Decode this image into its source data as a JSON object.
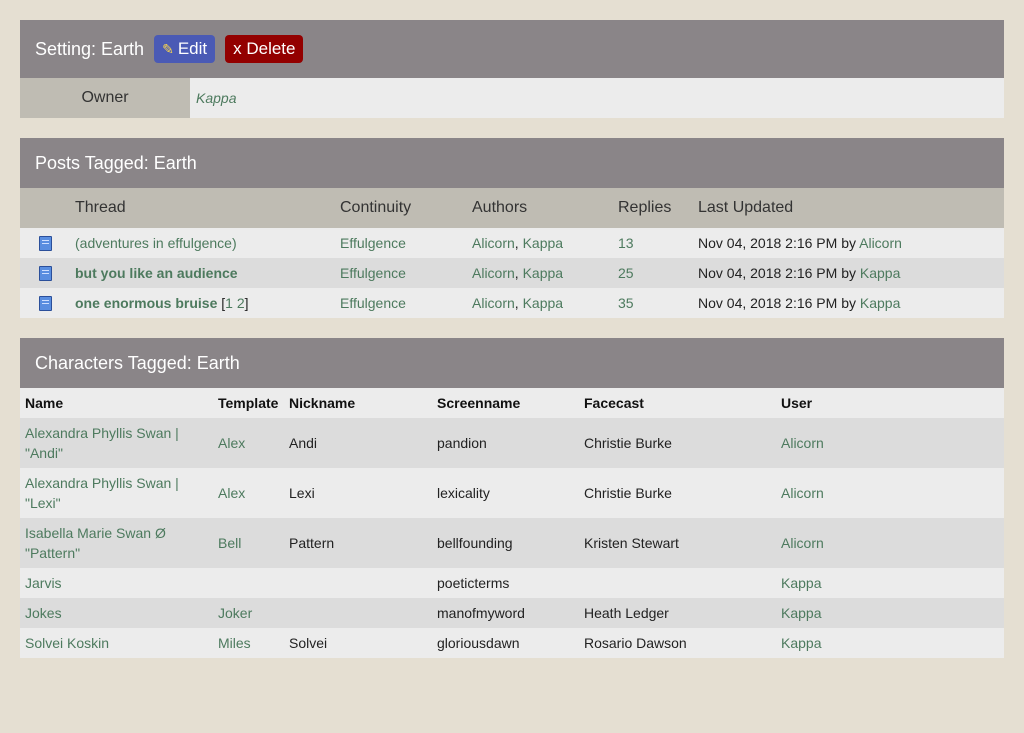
{
  "setting": {
    "title": "Setting: Earth",
    "edit_label": "Edit",
    "delete_label": "x Delete",
    "owner_label": "Owner",
    "owner_value": "Kappa"
  },
  "posts": {
    "title": "Posts Tagged: Earth",
    "columns": [
      "Thread",
      "Continuity",
      "Authors",
      "Replies",
      "Last Updated"
    ],
    "rows": [
      {
        "thread": "(adventures in effulgence)",
        "pages": [],
        "continuity": "Effulgence",
        "authors": [
          "Alicorn",
          "Kappa"
        ],
        "replies": "13",
        "updated": "Nov 04, 2018 2:16 PM",
        "by_word": "by",
        "updated_by": "Alicorn",
        "bold": false
      },
      {
        "thread": "but you like an audience",
        "pages": [],
        "continuity": "Effulgence",
        "authors": [
          "Alicorn",
          "Kappa"
        ],
        "replies": "25",
        "updated": "Nov 04, 2018 2:16 PM",
        "by_word": "by",
        "updated_by": "Kappa",
        "bold": true
      },
      {
        "thread": "one enormous bruise",
        "pages": [
          "1",
          "2"
        ],
        "continuity": "Effulgence",
        "authors": [
          "Alicorn",
          "Kappa"
        ],
        "replies": "35",
        "updated": "Nov 04, 2018 2:16 PM",
        "by_word": "by",
        "updated_by": "Kappa",
        "bold": true
      }
    ]
  },
  "characters": {
    "title": "Characters Tagged: Earth",
    "columns": [
      "Name",
      "Template",
      "Nickname",
      "Screenname",
      "Facecast",
      "User"
    ],
    "rows": [
      {
        "name": "Alexandra Phyllis Swan | \"Andi\"",
        "template": "Alex",
        "nickname": "Andi",
        "screenname": "pandion",
        "facecast": "Christie Burke",
        "user": "Alicorn"
      },
      {
        "name": "Alexandra Phyllis Swan | \"Lexi\"",
        "template": "Alex",
        "nickname": "Lexi",
        "screenname": "lexicality",
        "facecast": "Christie Burke",
        "user": "Alicorn"
      },
      {
        "name": "Isabella Marie Swan Ø \"Pattern\"",
        "template": "Bell",
        "nickname": "Pattern",
        "screenname": "bellfounding",
        "facecast": "Kristen Stewart",
        "user": "Alicorn"
      },
      {
        "name": "Jarvis",
        "template": "",
        "nickname": "",
        "screenname": "poeticterms",
        "facecast": "",
        "user": "Kappa"
      },
      {
        "name": "Jokes",
        "template": "Joker",
        "nickname": "",
        "screenname": "manofmyword",
        "facecast": "Heath Ledger",
        "user": "Kappa"
      },
      {
        "name": "Solvei Koskin",
        "template": "Miles",
        "nickname": "Solvei",
        "screenname": "gloriousdawn",
        "facecast": "Rosario Dawson",
        "user": "Kappa"
      }
    ]
  }
}
